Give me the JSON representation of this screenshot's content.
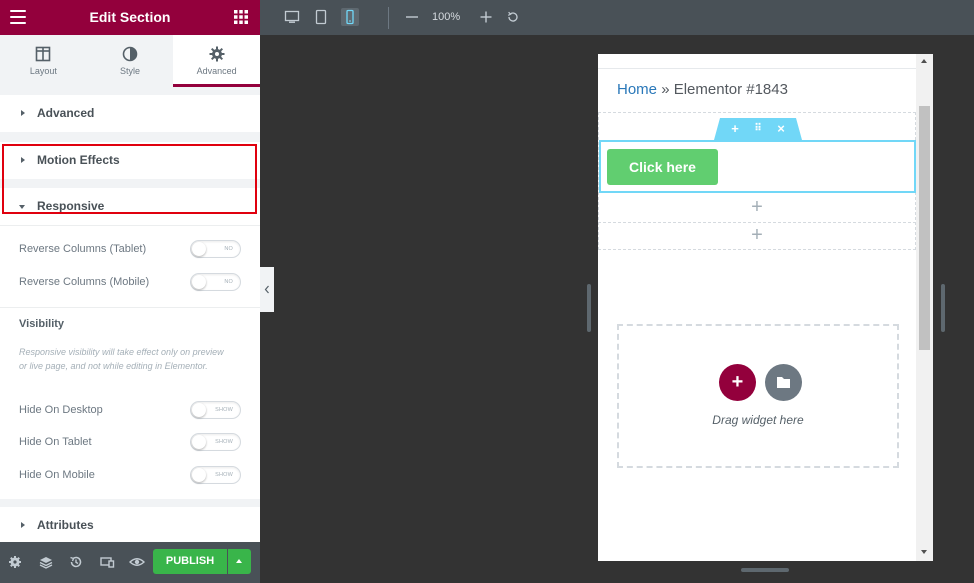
{
  "colors": {
    "brand": "#93003c",
    "publish": "#39b54a",
    "button": "#61ce70",
    "link": "#2a78b9",
    "highlight": "#e0000e",
    "selection": "#71d7f7"
  },
  "panel": {
    "title": "Edit Section",
    "menu_icon": "hamburger-icon",
    "grid_icon": "widgets-grid-icon",
    "tabs": [
      {
        "label": "Layout",
        "icon": "columns-icon"
      },
      {
        "label": "Style",
        "icon": "half-circle-icon"
      },
      {
        "label": "Advanced",
        "icon": "gear-icon",
        "active": true
      }
    ],
    "sections": {
      "advanced": "Advanced",
      "motion": "Motion Effects",
      "responsive": "Responsive",
      "attributes": "Attributes"
    },
    "responsive_controls": [
      {
        "label": "Reverse Columns (Tablet)",
        "state": "NO"
      },
      {
        "label": "Reverse Columns (Mobile)",
        "state": "NO"
      }
    ],
    "visibility": {
      "heading": "Visibility",
      "note": "Responsive visibility will take effect only on preview or live page, and not while editing in Elementor.",
      "controls": [
        {
          "label": "Hide On Desktop",
          "state": "SHOW"
        },
        {
          "label": "Hide On Tablet",
          "state": "SHOW"
        },
        {
          "label": "Hide On Mobile",
          "state": "SHOW"
        }
      ]
    },
    "footer": {
      "icons": [
        "settings-icon",
        "navigator-layers-icon",
        "history-icon",
        "responsive-mode-icon",
        "preview-eye-icon"
      ],
      "publish_label": "PUBLISH"
    }
  },
  "toolbar": {
    "devices": [
      "desktop-icon",
      "tablet-icon",
      "mobile-icon"
    ],
    "active_device": "mobile",
    "zoom": "100%"
  },
  "preview": {
    "breadcrumb": {
      "home": "Home",
      "separator": "»",
      "current": "Elementor #1843"
    },
    "button_label": "Click here",
    "drop_text": "Drag widget here"
  }
}
